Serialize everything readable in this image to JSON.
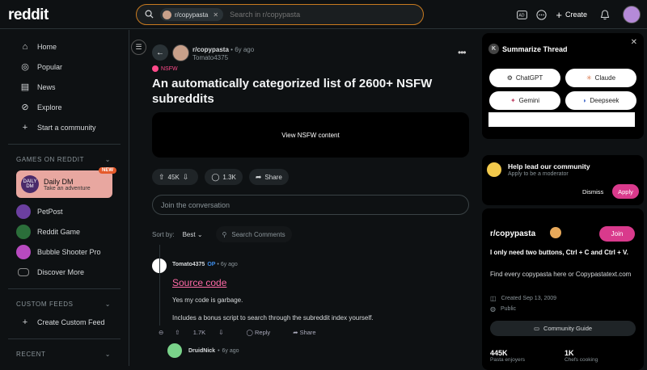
{
  "header": {
    "logo": "reddit",
    "search_chip": "r/copypasta",
    "search_placeholder": "Search in r/copypasta",
    "create_label": "Create"
  },
  "sidebar": {
    "nav": [
      {
        "label": "Home",
        "icon": "home-icon"
      },
      {
        "label": "Popular",
        "icon": "popular-icon"
      },
      {
        "label": "News",
        "icon": "news-icon"
      },
      {
        "label": "Explore",
        "icon": "explore-icon"
      },
      {
        "label": "Start a community",
        "icon": "plus-icon"
      }
    ],
    "games_header": "GAMES ON REDDIT",
    "featured_game": {
      "title": "Daily DM",
      "subtitle": "Take an adventure",
      "badge": "NEW",
      "icon_text": "DAILY DM"
    },
    "games": [
      "PetPost",
      "Reddit Game",
      "Bubble Shooter Pro",
      "Discover More"
    ],
    "custom_feeds_header": "CUSTOM FEEDS",
    "create_feed": "Create Custom Feed",
    "recent_header": "RECENT"
  },
  "post": {
    "subreddit": "r/copypasta",
    "age": "6y ago",
    "author": "Tomato4375",
    "nsfw_tag": "NSFW",
    "title": "An automatically categorized list of 2600+ NSFW subreddits",
    "nsfw_cta": "View NSFW content",
    "votes": "45K",
    "comments": "1.3K",
    "share": "Share",
    "join_placeholder": "Join the conversation",
    "sort_label": "Sort by:",
    "sort_value": "Best",
    "search_comments": "Search Comments"
  },
  "comment": {
    "author": "Tomato4375",
    "op": "OP",
    "age": "6y ago",
    "link": "Source code",
    "line1": "Yes my code is garbage.",
    "line2": "Includes a bonus script to search through the subreddit index yourself.",
    "votes": "1.7K",
    "reply": "Reply",
    "share": "Share"
  },
  "reply": {
    "author": "DruidNick",
    "age": "6y ago"
  },
  "summarize": {
    "title": "Summarize Thread",
    "k_icon": "K",
    "options": [
      "ChatGPT",
      "Claude",
      "Gemini",
      "Deepseek"
    ]
  },
  "lead": {
    "title": "Help lead our community",
    "subtitle": "Apply to be a moderator",
    "dismiss": "Dismiss",
    "apply": "Apply"
  },
  "community": {
    "name": "r/copypasta",
    "join": "Join",
    "desc": "I only need two buttons, Ctrl + C and Ctrl + V.",
    "desc2": "Find every copypasta here or Copypastatext.com",
    "created": "Created Sep 13, 2009",
    "visibility": "Public",
    "guide": "Community Guide",
    "members": "445K",
    "members_label": "Pasta enjoyers",
    "online": "1K",
    "online_label": "Chefs cooking"
  },
  "colors": {
    "accent_pink": "#d93a8c",
    "search_border": "#c87a1f",
    "bg": "#0e1113"
  }
}
